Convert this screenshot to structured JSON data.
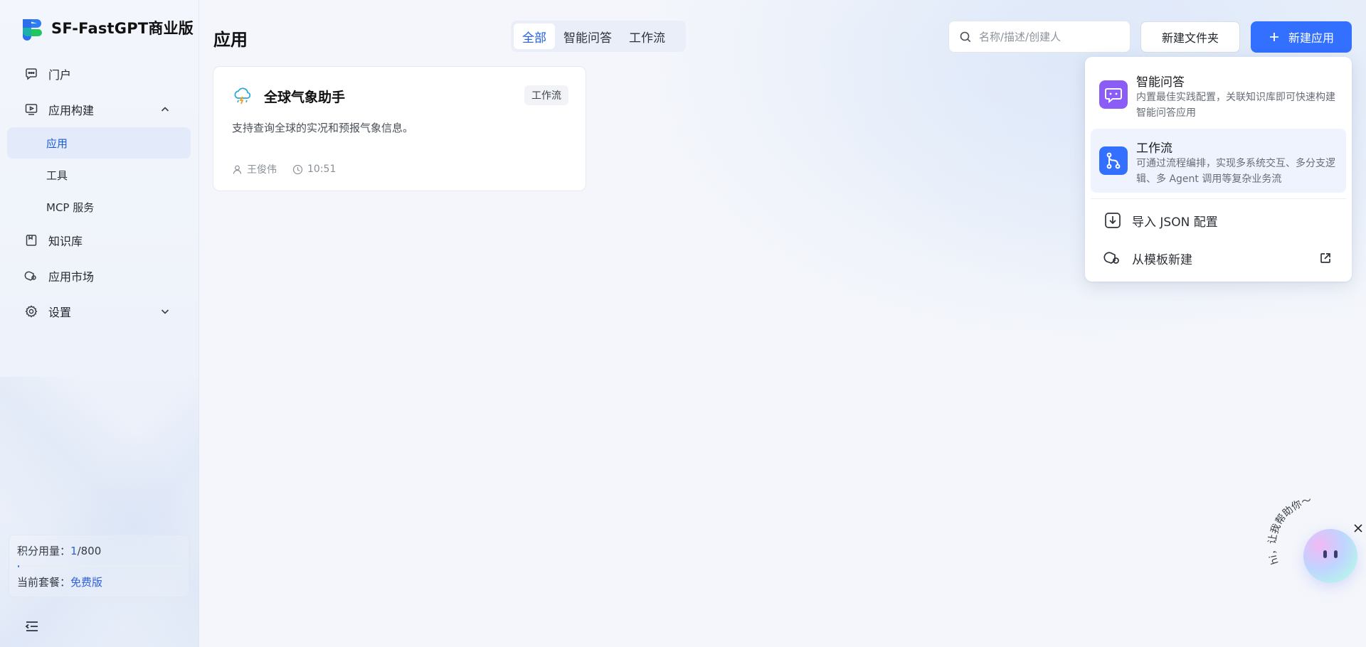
{
  "brand": {
    "name": "SF-FastGPT商业版"
  },
  "sidebar": {
    "nav": [
      {
        "label": "门户",
        "icon": "chat-bubble-icon"
      },
      {
        "label": "应用构建",
        "icon": "monitor-play-icon",
        "expanded": true
      },
      {
        "label": "知识库",
        "icon": "book-icon"
      },
      {
        "label": "应用市场",
        "icon": "market-icon"
      },
      {
        "label": "设置",
        "icon": "gear-icon",
        "expanded": false
      }
    ],
    "subnav": [
      {
        "label": "应用",
        "active": true
      },
      {
        "label": "工具"
      },
      {
        "label": "MCP 服务"
      }
    ],
    "usage": {
      "points_label": "积分用量：",
      "points_used": "1",
      "points_total": "/800",
      "points_fraction": 0.00125,
      "plan_label": "当前套餐：",
      "plan_value": "免费版"
    }
  },
  "header": {
    "title": "应用",
    "tabs": [
      {
        "label": "全部",
        "active": true
      },
      {
        "label": "智能问答"
      },
      {
        "label": "工作流"
      }
    ],
    "search_placeholder": "名称/描述/创建人",
    "new_folder_label": "新建文件夹",
    "new_app_label": "新建应用"
  },
  "apps": [
    {
      "name": "全球气象助手",
      "tag": "工作流",
      "description": "支持查询全球的实况和预报气象信息。",
      "author": "王俊伟",
      "time": "10:51",
      "icon": "cloud-lightning-icon"
    }
  ],
  "create_menu": {
    "items": [
      {
        "title": "智能问答",
        "desc": "内置最佳实践配置，关联知识库即可快速构建智能问答应用",
        "icon": "chat-bot-icon",
        "color": "#8b5cf6"
      },
      {
        "title": "工作流",
        "desc": "可通过流程编排，实现多系统交互、多分支逻辑、多 Agent 调用等复杂业务流",
        "icon": "workflow-icon",
        "color": "#3370ff"
      }
    ],
    "import_label": "导入 JSON 配置",
    "template_label": "从模板新建"
  },
  "assistant": {
    "greeting": "hi，让我帮助你～"
  },
  "colors": {
    "accent": "#3370ff",
    "active_nav_bg": "#e3ebfa"
  }
}
